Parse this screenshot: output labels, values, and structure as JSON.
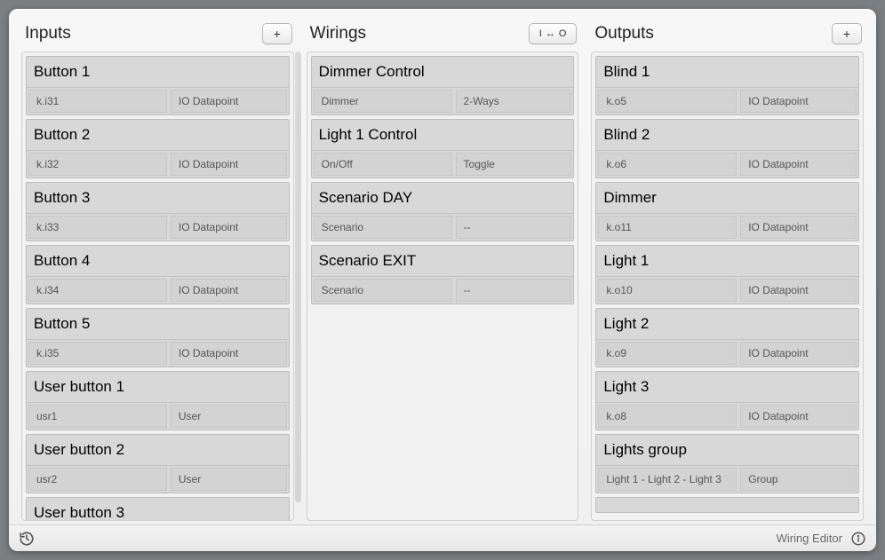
{
  "footer": {
    "label": "Wiring Editor"
  },
  "columns": {
    "inputs": {
      "title": "Inputs",
      "add_label": "+",
      "items": [
        {
          "name": "Button 1",
          "left": "k.i31",
          "right": "IO Datapoint"
        },
        {
          "name": "Button 2",
          "left": "k.i32",
          "right": "IO Datapoint"
        },
        {
          "name": "Button 3",
          "left": "k.i33",
          "right": "IO Datapoint"
        },
        {
          "name": "Button 4",
          "left": "k.i34",
          "right": "IO Datapoint"
        },
        {
          "name": "Button 5",
          "left": "k.i35",
          "right": "IO Datapoint"
        },
        {
          "name": "User button 1",
          "left": "usr1",
          "right": "User"
        },
        {
          "name": "User button 2",
          "left": "usr2",
          "right": "User"
        },
        {
          "name": "User button 3",
          "left": "",
          "right": ""
        }
      ]
    },
    "wirings": {
      "title": "Wirings",
      "link_label": "I ↔ O",
      "items": [
        {
          "name": "Dimmer Control",
          "left": "Dimmer",
          "right": "2-Ways"
        },
        {
          "name": "Light 1 Control",
          "left": "On/Off",
          "right": "Toggle"
        },
        {
          "name": "Scenario DAY",
          "left": "Scenario",
          "right": "--"
        },
        {
          "name": "Scenario EXIT",
          "left": "Scenario",
          "right": "--"
        }
      ]
    },
    "outputs": {
      "title": "Outputs",
      "add_label": "+",
      "items": [
        {
          "name": "Blind 1",
          "left": "k.o5",
          "right": "IO Datapoint"
        },
        {
          "name": "Blind 2",
          "left": "k.o6",
          "right": "IO Datapoint"
        },
        {
          "name": "Dimmer",
          "left": "k.o11",
          "right": "IO Datapoint"
        },
        {
          "name": "Light 1",
          "left": "k.o10",
          "right": "IO Datapoint"
        },
        {
          "name": "Light 2",
          "left": "k.o9",
          "right": "IO Datapoint"
        },
        {
          "name": "Light 3",
          "left": "k.o8",
          "right": "IO Datapoint"
        },
        {
          "name": "Lights group",
          "left": "Light 1 - Light 2 - Light 3",
          "right": "Group"
        }
      ],
      "blank": {
        "name": ""
      }
    }
  }
}
